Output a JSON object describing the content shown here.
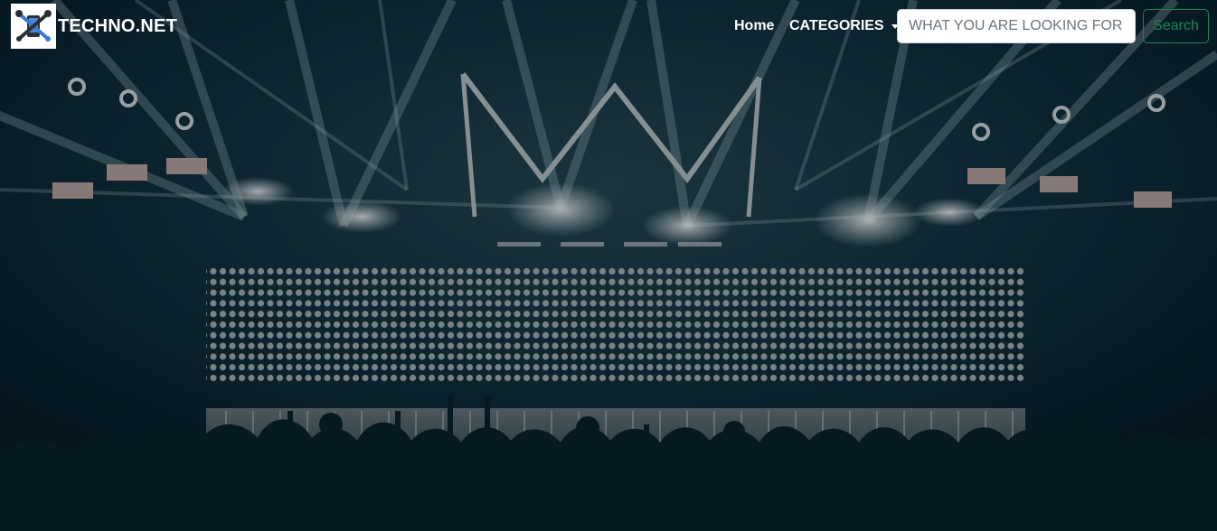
{
  "brand": {
    "name": "TECHNO.NET",
    "logo_icon": "tools-icon"
  },
  "nav": {
    "home_label": "Home",
    "categories_label": "CATEGORIES"
  },
  "search": {
    "placeholder": "WHAT YOU ARE LOOKING FOR",
    "value": "",
    "button_label": "Search"
  },
  "colors": {
    "background": "#0a1c26",
    "accent": "#198754",
    "text": "#ffffff"
  },
  "hero_image": "concert-stage-with-lights-and-crowd"
}
